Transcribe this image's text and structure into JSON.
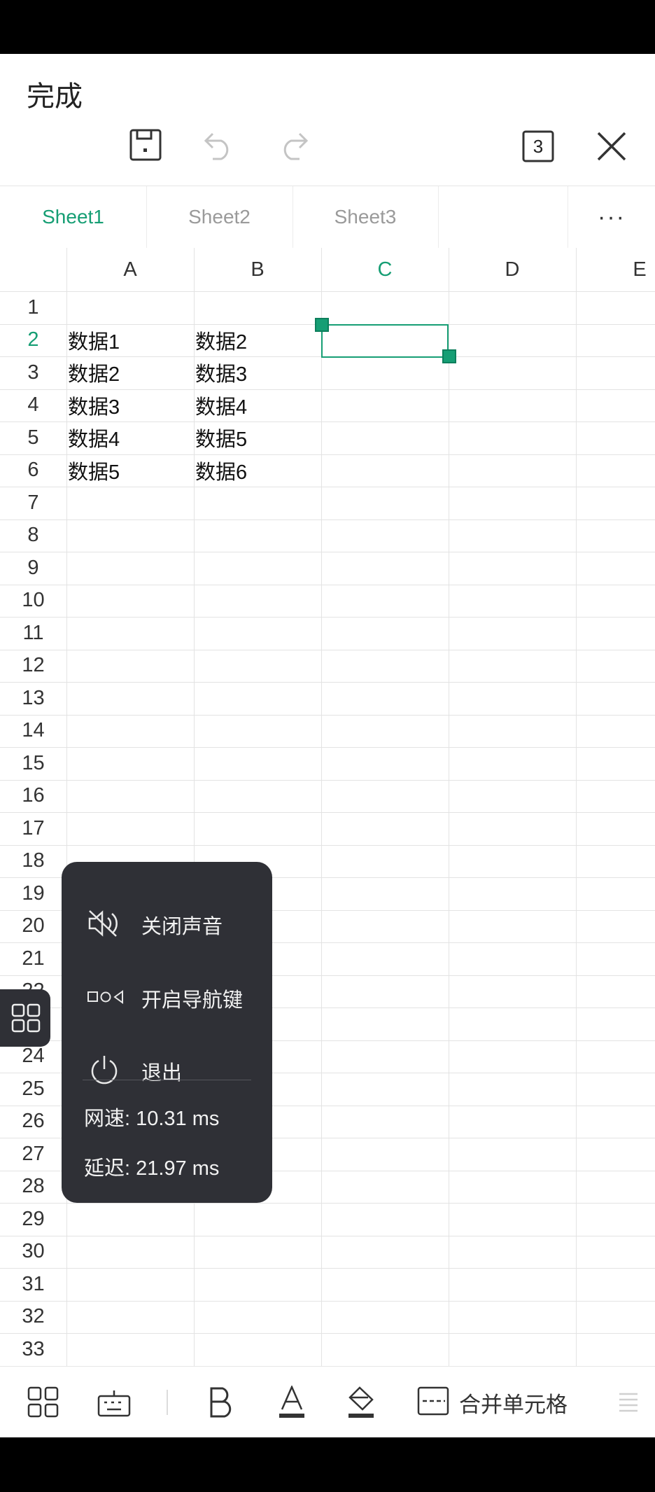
{
  "appbar": {
    "done_label": "完成",
    "icons": [
      "save-icon",
      "undo-icon",
      "redo-icon",
      "tabs-count-icon",
      "close-icon"
    ],
    "tab_count": "3"
  },
  "sheets": {
    "tabs": [
      "Sheet1",
      "Sheet2",
      "Sheet3"
    ],
    "active": "Sheet1",
    "more_label": "···"
  },
  "grid": {
    "columns": [
      "A",
      "B",
      "C",
      "D",
      "E"
    ],
    "selected_column": "C",
    "rows": [
      "1",
      "2",
      "3",
      "4",
      "5",
      "6",
      "7",
      "8",
      "9",
      "10",
      "11",
      "12",
      "13",
      "14",
      "15",
      "16",
      "17",
      "18",
      "19",
      "20",
      "21",
      "22",
      "23",
      "24",
      "25",
      "26",
      "27",
      "28",
      "29",
      "30",
      "31",
      "32",
      "33"
    ],
    "selected_row": "2",
    "cells": [
      {
        "row": "2",
        "col": "A",
        "value": "数据1"
      },
      {
        "row": "2",
        "col": "B",
        "value": "数据2"
      },
      {
        "row": "3",
        "col": "A",
        "value": "数据2"
      },
      {
        "row": "3",
        "col": "B",
        "value": "数据3"
      },
      {
        "row": "4",
        "col": "A",
        "value": "数据3"
      },
      {
        "row": "4",
        "col": "B",
        "value": "数据4"
      },
      {
        "row": "5",
        "col": "A",
        "value": "数据4"
      },
      {
        "row": "5",
        "col": "B",
        "value": "数据5"
      },
      {
        "row": "6",
        "col": "A",
        "value": "数据5"
      },
      {
        "row": "6",
        "col": "B",
        "value": "数据6"
      }
    ],
    "selected_cell": "C2"
  },
  "float_menu": {
    "items": [
      {
        "label": "关闭声音",
        "icon": "mute-icon"
      },
      {
        "label": "开启导航键",
        "icon": "nav-keys-icon"
      },
      {
        "label": "退出",
        "icon": "power-icon"
      }
    ],
    "net_speed": "网速: 10.31 ms",
    "latency": "延迟: 21.97 ms"
  },
  "toolbar": {
    "merge_label": "合并单元格",
    "icons": [
      "apps-icon",
      "keyboard-icon",
      "bold-icon",
      "font-color-icon",
      "fill-color-icon",
      "merge-cells-icon",
      "align-icon"
    ]
  },
  "colors": {
    "accent": "#169e74",
    "menu_bg": "#2f3036"
  }
}
